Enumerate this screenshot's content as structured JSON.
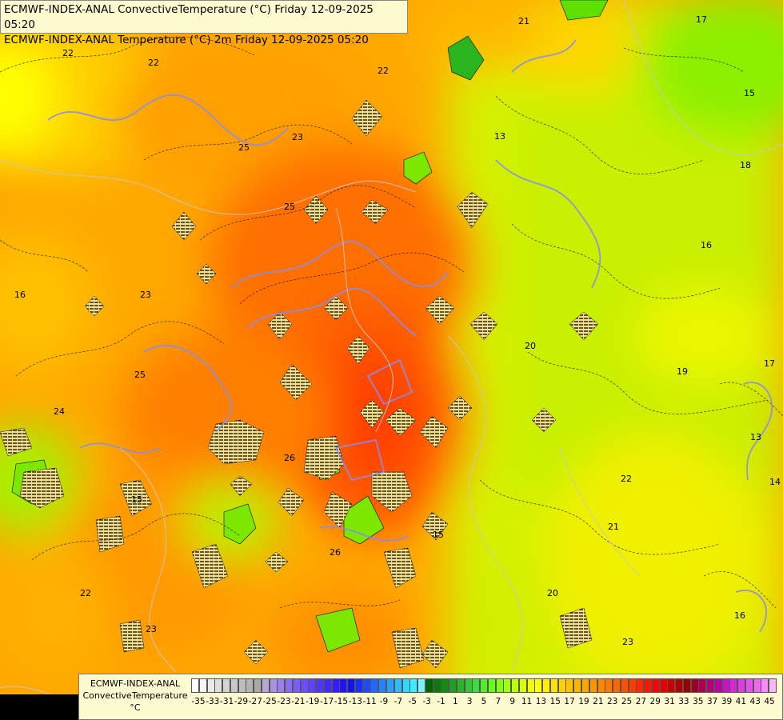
{
  "title": {
    "line1": "ECMWF-INDEX-ANAL ConvectiveTemperature (°C) Friday 12-09-2025 05:20",
    "line2": "ECMWF-INDEX-ANAL Temperature (°C) 2m Friday 12-09-2025 05:20"
  },
  "legend": {
    "name_line1": "ECMWF-INDEX-ANAL",
    "name_line2": "ConvectiveTemperature",
    "unit": "°C",
    "ticks": [
      "-35",
      "-33",
      "-31",
      "-29",
      "-27",
      "-25",
      "-23",
      "-21",
      "-19",
      "-17",
      "-15",
      "-13",
      "-11",
      "-9",
      "-7",
      "-5",
      "-3",
      "-1",
      "1",
      "3",
      "5",
      "7",
      "9",
      "11",
      "13",
      "15",
      "17",
      "19",
      "21",
      "23",
      "25",
      "27",
      "29",
      "31",
      "33",
      "35",
      "37",
      "39",
      "41",
      "43",
      "45"
    ],
    "colors": [
      "#ffffff",
      "#f4f4f4",
      "#e9e9e9",
      "#dedede",
      "#d3d3d3",
      "#c8c8c8",
      "#bdbdbd",
      "#b3b3b3",
      "#a8a8a8",
      "#b8a6d6",
      "#a993e0",
      "#9a80ea",
      "#8b6df4",
      "#7c5afe",
      "#6f4cff",
      "#6240ff",
      "#5234ff",
      "#4228ff",
      "#321cff",
      "#2210ff",
      "#1414f0",
      "#1830ff",
      "#1c4cff",
      "#2068ff",
      "#2484ff",
      "#28a0ff",
      "#2cbcff",
      "#30d8ff",
      "#3cecff",
      "#78f4ff",
      "#006400",
      "#0a7a0a",
      "#148c14",
      "#1ea01e",
      "#28b428",
      "#32c832",
      "#3cdc3c",
      "#50ee28",
      "#64ff14",
      "#82ff10",
      "#a0ff0c",
      "#beff08",
      "#d8ff04",
      "#f0ff00",
      "#ffff00",
      "#fff000",
      "#ffe100",
      "#ffd200",
      "#ffc300",
      "#ffb400",
      "#ffa500",
      "#ff9600",
      "#ff8700",
      "#ff7800",
      "#ff6400",
      "#ff5000",
      "#ff3c00",
      "#ff2800",
      "#ff1400",
      "#ff0000",
      "#e60000",
      "#cc0000",
      "#b30000",
      "#990000",
      "#a00028",
      "#aa0050",
      "#b40078",
      "#be00a0",
      "#c814c0",
      "#d228d4",
      "#dc3ce0",
      "#e650ec",
      "#f064f6",
      "#f88cfa",
      "#fcb4fc"
    ],
    "contour_labels": [
      "22",
      "22",
      "23",
      "25",
      "25",
      "23",
      "24",
      "25",
      "26",
      "26",
      "21",
      "22",
      "23",
      "17",
      "15",
      "13",
      "16",
      "16",
      "18",
      "17",
      "14",
      "19",
      "20",
      "21",
      "22",
      "23",
      "16",
      "15",
      "13",
      "15",
      "20",
      "22"
    ]
  }
}
